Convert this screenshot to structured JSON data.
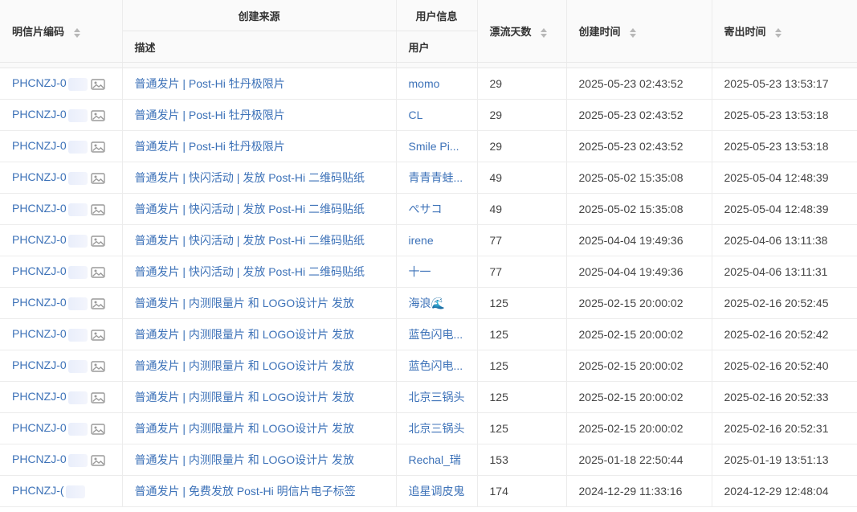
{
  "headers": {
    "code": "明信片编码",
    "source_group": "创建来源",
    "description": "描述",
    "user_group": "用户信息",
    "user": "用户",
    "days": "漂流天数",
    "created": "创建时间",
    "sent": "寄出时间"
  },
  "code_prefix": "PHCNZJ-0",
  "code_prefix_cut": "PHCNZJ-(",
  "rows": [
    {
      "desc": "普通发片 | Post-Hi 牡丹极限片",
      "user": "momo",
      "days": "29",
      "created": "2025-05-23 02:43:52",
      "sent": "2025-05-23 13:53:17",
      "has_image": true
    },
    {
      "desc": "普通发片 | Post-Hi 牡丹极限片",
      "user": "CL",
      "days": "29",
      "created": "2025-05-23 02:43:52",
      "sent": "2025-05-23 13:53:18",
      "has_image": true
    },
    {
      "desc": "普通发片 | Post-Hi 牡丹极限片",
      "user": "Smile Pi...",
      "days": "29",
      "created": "2025-05-23 02:43:52",
      "sent": "2025-05-23 13:53:18",
      "has_image": true
    },
    {
      "desc": "普通发片 | 快闪活动 | 发放 Post-Hi 二维码贴纸",
      "user": "青青青蛙...",
      "days": "49",
      "created": "2025-05-02 15:35:08",
      "sent": "2025-05-04 12:48:39",
      "has_image": true
    },
    {
      "desc": "普通发片 | 快闪活动 | 发放 Post-Hi 二维码贴纸",
      "user": "ぺサコ",
      "days": "49",
      "created": "2025-05-02 15:35:08",
      "sent": "2025-05-04 12:48:39",
      "has_image": true
    },
    {
      "desc": "普通发片 | 快闪活动 | 发放 Post-Hi 二维码贴纸",
      "user": "irene",
      "days": "77",
      "created": "2025-04-04 19:49:36",
      "sent": "2025-04-06 13:11:38",
      "has_image": true
    },
    {
      "desc": "普通发片 | 快闪活动 | 发放 Post-Hi 二维码贴纸",
      "user": "十一",
      "days": "77",
      "created": "2025-04-04 19:49:36",
      "sent": "2025-04-06 13:11:31",
      "has_image": true
    },
    {
      "desc": "普通发片 | 内测限量片 和 LOGO设计片 发放",
      "user": "海浪🌊",
      "days": "125",
      "created": "2025-02-15 20:00:02",
      "sent": "2025-02-16 20:52:45",
      "has_image": true
    },
    {
      "desc": "普通发片 | 内测限量片 和 LOGO设计片 发放",
      "user": "蓝色闪电...",
      "days": "125",
      "created": "2025-02-15 20:00:02",
      "sent": "2025-02-16 20:52:42",
      "has_image": true
    },
    {
      "desc": "普通发片 | 内测限量片 和 LOGO设计片 发放",
      "user": "蓝色闪电...",
      "days": "125",
      "created": "2025-02-15 20:00:02",
      "sent": "2025-02-16 20:52:40",
      "has_image": true
    },
    {
      "desc": "普通发片 | 内测限量片 和 LOGO设计片 发放",
      "user": "北京三锅头",
      "days": "125",
      "created": "2025-02-15 20:00:02",
      "sent": "2025-02-16 20:52:33",
      "has_image": true
    },
    {
      "desc": "普通发片 | 内测限量片 和 LOGO设计片 发放",
      "user": "北京三锅头",
      "days": "125",
      "created": "2025-02-15 20:00:02",
      "sent": "2025-02-16 20:52:31",
      "has_image": true
    },
    {
      "desc": "普通发片 | 内测限量片 和 LOGO设计片 发放",
      "user": "Rechal_瑞",
      "days": "153",
      "created": "2025-01-18 22:50:44",
      "sent": "2025-01-19 13:51:13",
      "has_image": true
    },
    {
      "desc": "普通发片 | 免费发放 Post-Hi 明信片电子标签",
      "user": "追星调皮鬼",
      "days": "174",
      "created": "2024-12-29 11:33:16",
      "sent": "2024-12-29 12:48:04",
      "has_image": false
    }
  ],
  "colors": {
    "link": "#3d72b8",
    "header_bg": "#fafafa",
    "border": "#ececec"
  }
}
